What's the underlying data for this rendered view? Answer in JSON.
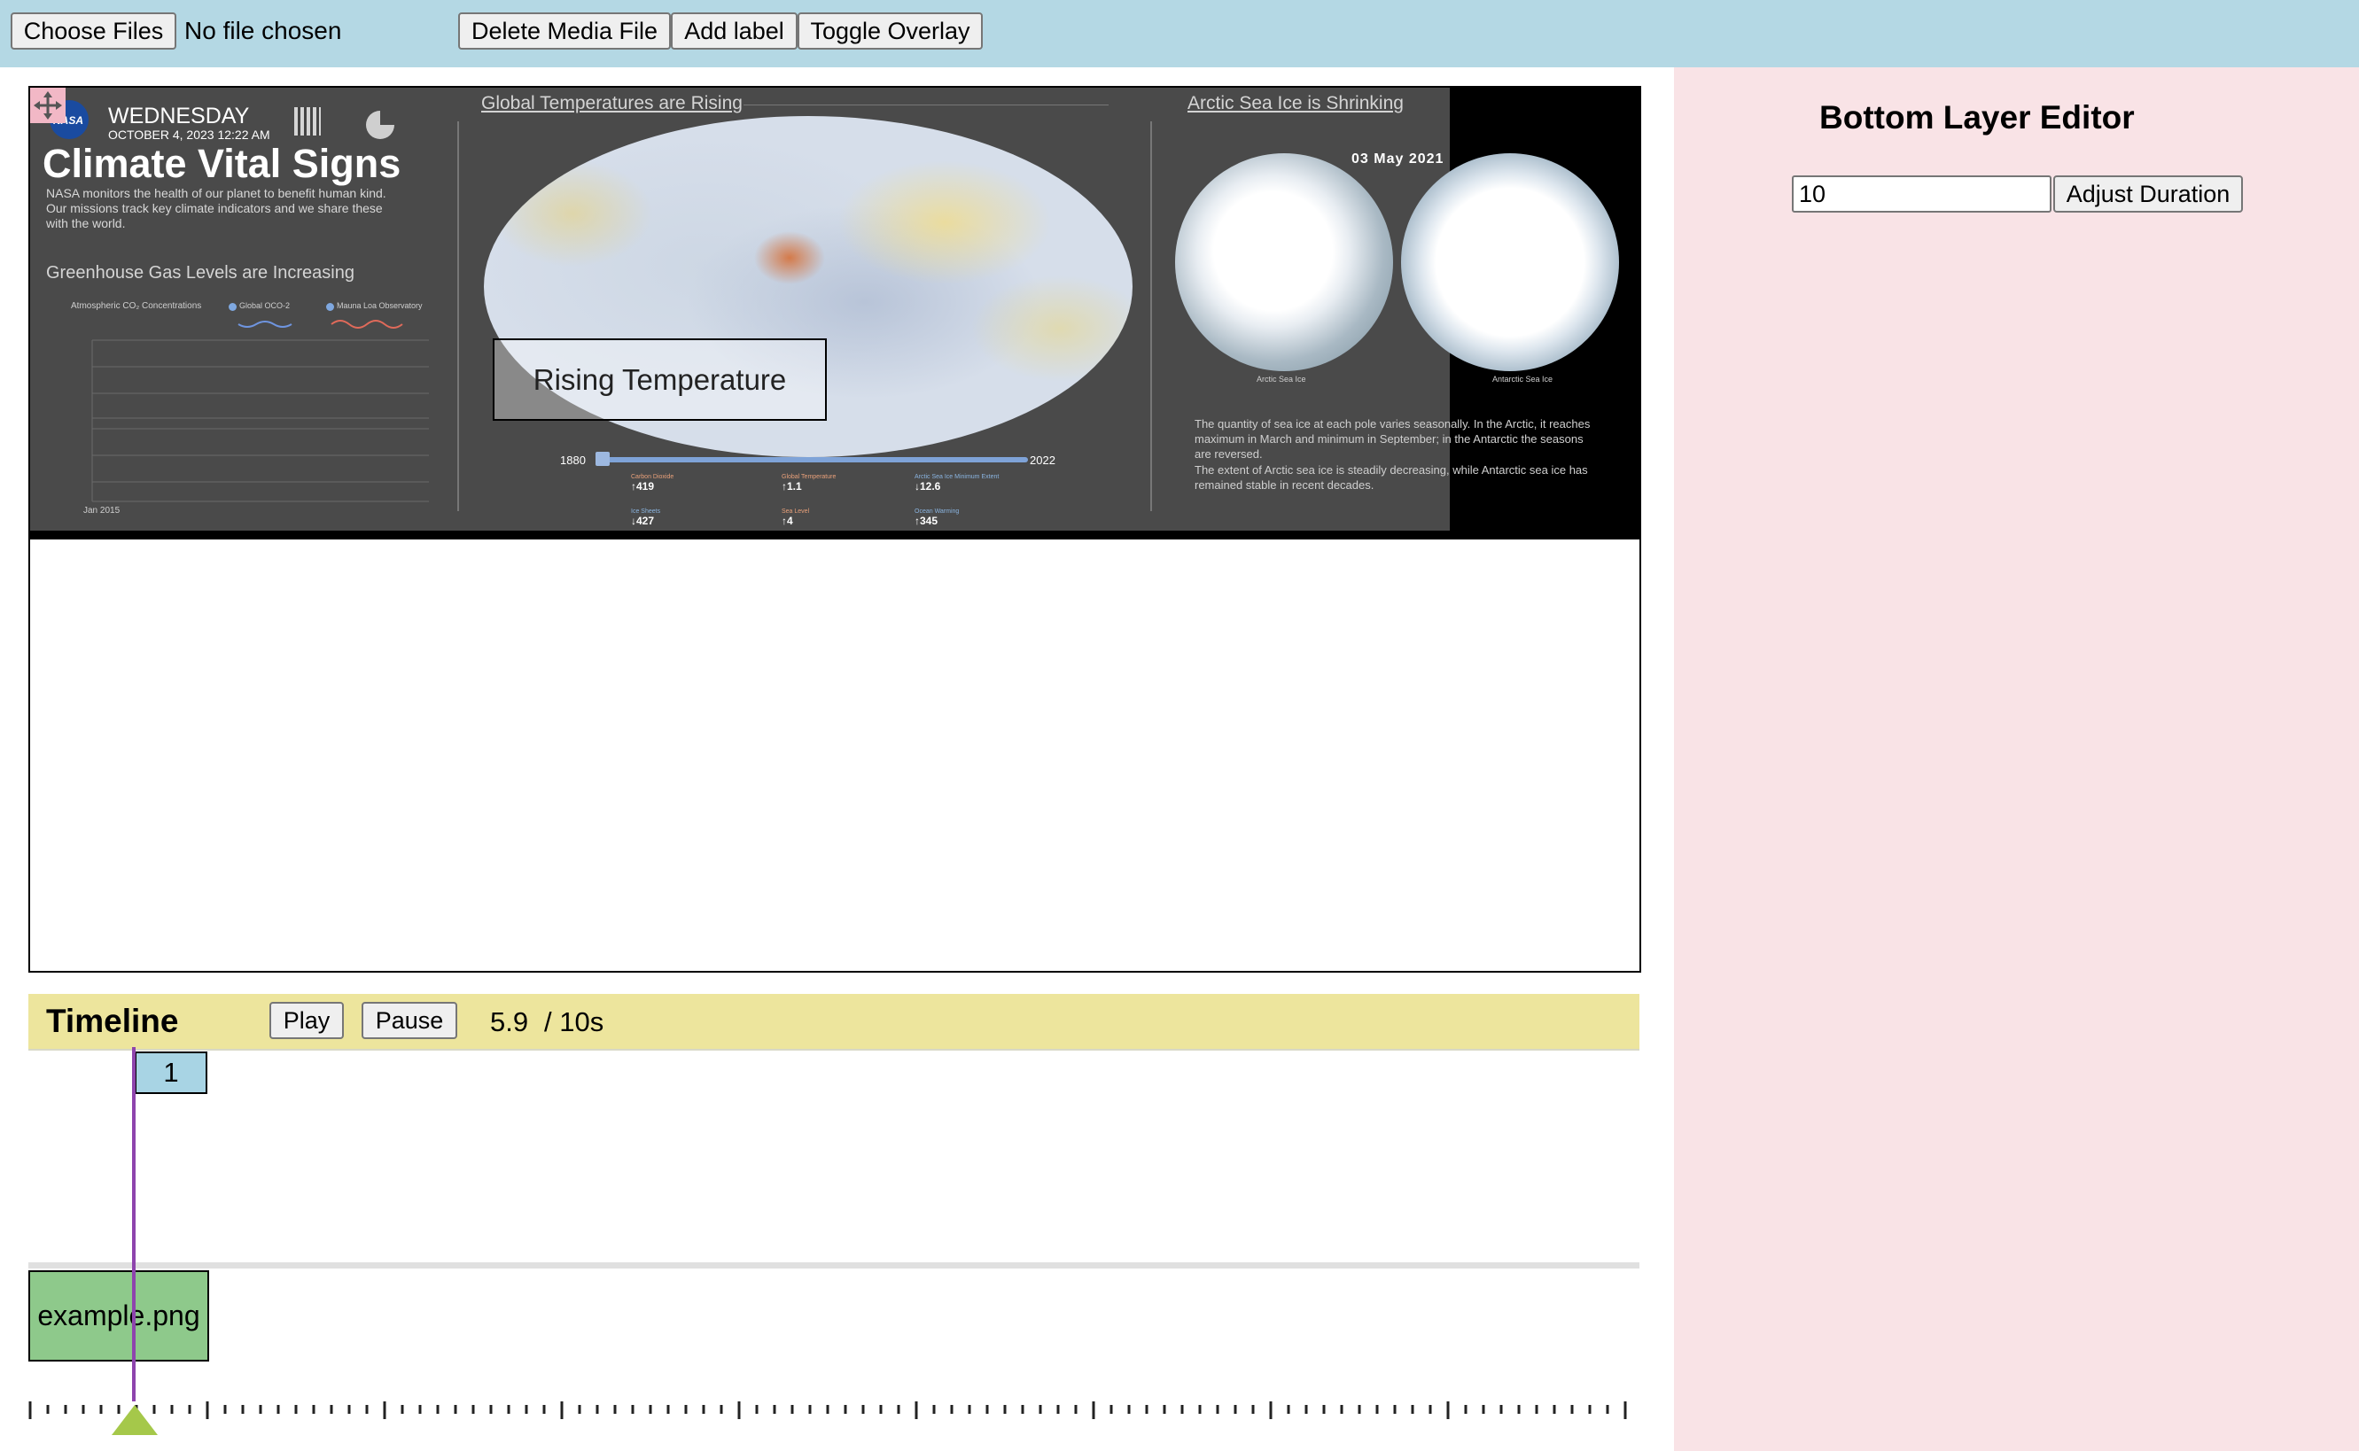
{
  "toolbar": {
    "choose_files": "Choose Files",
    "no_file": "No file chosen",
    "delete_media": "Delete Media File",
    "add_label": "Add label",
    "toggle_overlay": "Toggle Overlay"
  },
  "poster": {
    "logo_text": "NASA",
    "day": "WEDNESDAY",
    "date_time": "OCTOBER 4, 2023  12:22 AM",
    "title": "Climate Vital Signs",
    "description": "NASA monitors the health of our planet to benefit human kind. Our missions track key climate indicators and we share these with the world.",
    "greenhouse_heading": "Greenhouse Gas Levels are Increasing",
    "co2_label": "Atmospheric CO₂ Concentrations",
    "co2_legend_1": "Global OCO-2",
    "co2_legend_2": "Mauna Loa Observatory",
    "co2_axis_start": "Jan 2015",
    "temp_heading": "Global Temperatures are Rising",
    "slider_start": "1880",
    "slider_end": "2022",
    "indicators": [
      {
        "name": "Carbon Dioxide",
        "value": "↑419",
        "color": "#e8a07a"
      },
      {
        "name": "Global Temperature",
        "value": "↑1.1",
        "color": "#e8a07a"
      },
      {
        "name": "Arctic Sea Ice Minimum Extent",
        "value": "↓12.6",
        "color": "#8ab4e0"
      },
      {
        "name": "Ice Sheets",
        "value": "↓427",
        "color": "#8ab4e0"
      },
      {
        "name": "Sea Level",
        "value": "↑4",
        "color": "#e8a07a"
      },
      {
        "name": "Ocean Warming",
        "value": "↑345",
        "color": "#8ab4e0"
      }
    ],
    "ice_heading": "Arctic Sea Ice is Shrinking",
    "ice_date": "03 May 2021",
    "arctic_label": "Arctic Sea Ice",
    "antarctic_label": "Antarctic Sea Ice",
    "ice_text_1": "The quantity of sea ice at each pole varies seasonally. In the Arctic, it reaches maximum in March and minimum in September; in the Antarctic the seasons are reversed.",
    "ice_text_2": "The extent of Arctic sea ice is steadily decreasing, while Antarctic sea ice has remained stable in recent decades."
  },
  "overlay_label": "Rising Temperature",
  "editor": {
    "title": "Bottom Layer Editor",
    "duration_value": "10",
    "adjust_button": "Adjust Duration"
  },
  "timeline": {
    "title": "Timeline",
    "play": "Play",
    "pause": "Pause",
    "current_time": "5.9",
    "total_time": "/ 10s",
    "label_clip": "1",
    "media_clip": "example.png",
    "playhead_fraction": 0.059,
    "colors": {
      "header": "#ede59d",
      "label_clip": "#a8d4e4",
      "media_clip": "#8ec98b",
      "playhead": "#8e44ad",
      "playhead_marker": "#a5c84a"
    }
  }
}
